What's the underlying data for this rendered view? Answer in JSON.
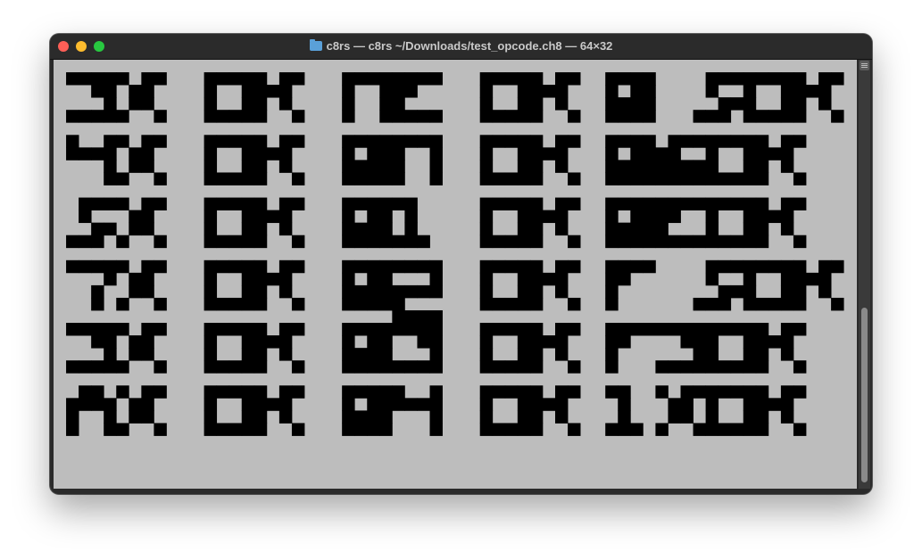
{
  "window": {
    "title": "c8rs — c8rs ~/Downloads/test_opcode.ch8 — 64×32",
    "title_icon": "folder-icon"
  },
  "display": {
    "background": "#bdbdbd",
    "pixel_color": "#000000",
    "rows": [
      [
        "3X OK",
        "0E OK",
        "8 5OK"
      ],
      [
        "4X OK",
        "80 OK",
        "86OK"
      ],
      [
        "5X OK",
        "81 OK",
        "8EOK"
      ],
      [
        "7X OK",
        "82 OK",
        "F 5OK"
      ],
      [
        "9X OK",
        "83 OK",
        "F3OK"
      ],
      [
        "AX OK",
        "84 OK",
        "1XOK"
      ]
    ]
  }
}
